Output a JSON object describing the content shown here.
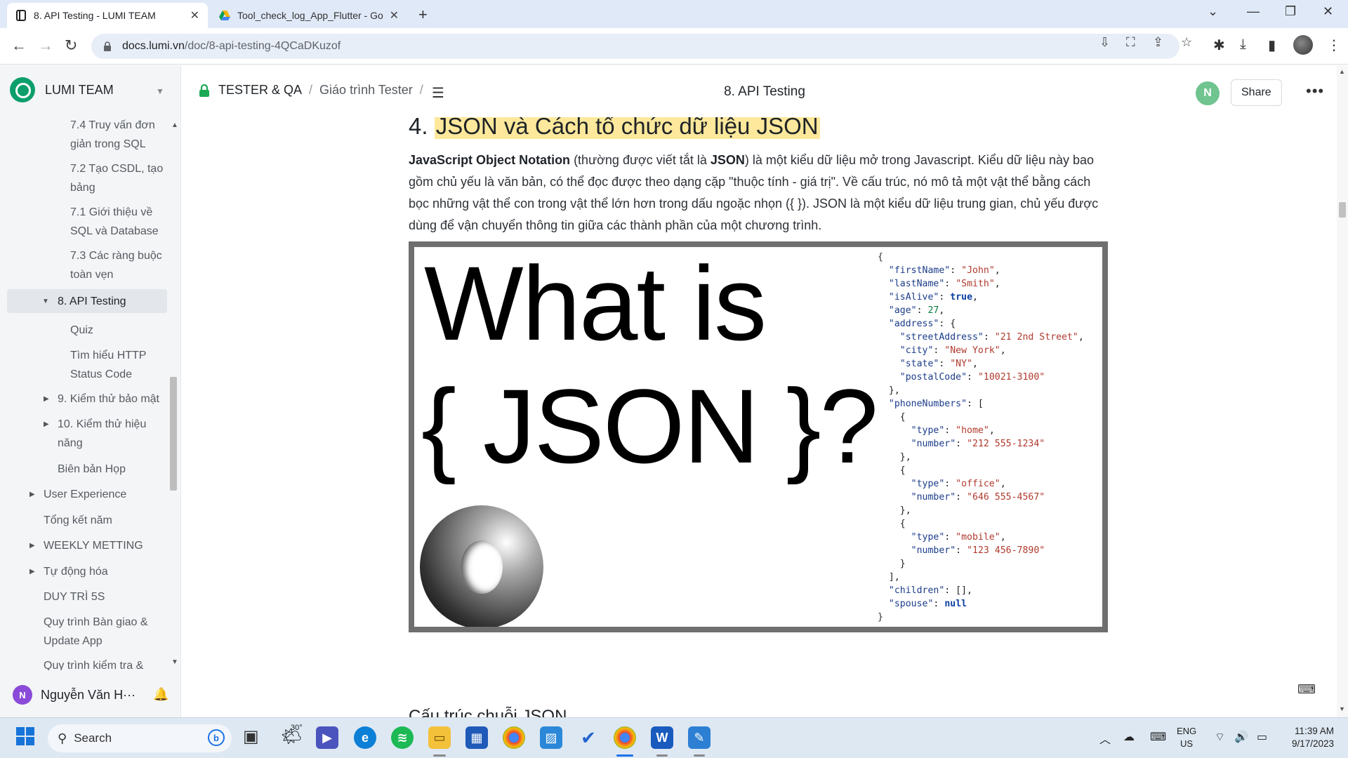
{
  "browser": {
    "tabs": [
      {
        "title": "8. API Testing - LUMI TEAM",
        "active": true
      },
      {
        "title": "Tool_check_log_App_Flutter - Go",
        "active": false
      }
    ],
    "url_host": "docs.lumi.vn",
    "url_path": "/doc/8-api-testing-4QCaDKuzof"
  },
  "sidebar": {
    "workspace": "LUMI TEAM",
    "items": [
      {
        "label": "7.4 Truy vấn đơn",
        "label2": "giản trong SQL"
      },
      {
        "label": "7.2 Tạo CSDL, tạo",
        "label2": "bảng"
      },
      {
        "label": "7.1 Giới thiệu về",
        "label2": "SQL và Database"
      },
      {
        "label": "7.3 Các ràng buộc",
        "label2": "toàn vẹn"
      },
      {
        "label": "8. API Testing"
      },
      {
        "label": "Quiz"
      },
      {
        "label": "Tìm hiểu HTTP",
        "label2": "Status Code"
      },
      {
        "label": "9. Kiểm thử bảo mật"
      },
      {
        "label": "10. Kiểm thử hiệu",
        "label2": "năng"
      },
      {
        "label": "Biên bản Họp"
      },
      {
        "label": "User Experience"
      },
      {
        "label": "Tổng kết năm"
      },
      {
        "label": "WEEKLY METTING"
      },
      {
        "label": "Tự động hóa"
      },
      {
        "label": "DUY TRÌ 5S"
      },
      {
        "label": "Quy trình Bàn giao &",
        "label2": "Update App"
      },
      {
        "label": "Quy trình kiểm tra &"
      }
    ],
    "user_initial": "N",
    "user_name": "Nguyễn Văn H···"
  },
  "header": {
    "crumb_collection": "TESTER & QA",
    "crumb_parent": "Giáo trình Tester",
    "title": "8. API Testing",
    "avatar_initial": "N",
    "share_label": "Share"
  },
  "content": {
    "heading_num": "4.",
    "heading_text": "JSON và Cách tổ chức dữ liệu JSON",
    "p_bold1": "JavaScript Object Notation",
    "p_t1": " (thường được viết tắt là ",
    "p_bold2": "JSON",
    "p_t2": ") là một kiểu dữ liệu mở trong Javascript. Kiểu dữ liệu này bao gồm chủ yếu là văn bản, có thể đọc được theo dạng cặp \"thuộc tính - giá trị\". Về cấu trúc, nó mô tả một vật thể bằng cách bọc những vật thể con trong vật thể lớn hơn trong dấu ngoặc nhọn ({ }). JSON là một kiểu dữ liệu trung gian, chủ yếu được dùng để vận chuyển thông tin giữa các thành phần của một chương trình.",
    "figure_line1": "What is",
    "figure_line2": "{ JSON }?",
    "subheading": "Cấu trúc chuỗi JSON"
  },
  "taskbar": {
    "search_label": "Search",
    "weather": "30°",
    "lang1": "ENG",
    "lang2": "US",
    "time": "11:39 AM",
    "date": "9/17/2023"
  }
}
